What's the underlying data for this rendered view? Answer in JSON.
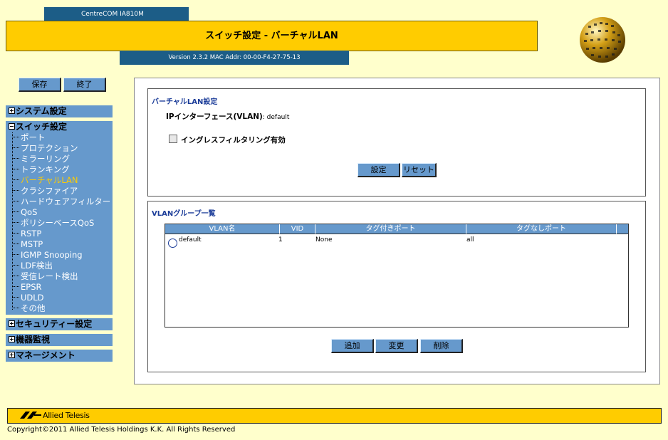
{
  "header": {
    "model": "CentreCOM IA810M",
    "title": "スイッチ設定 - バーチャルLAN",
    "version_info": "Version 2.3.2 MAC Addr: 00-00-F4-27-75-13"
  },
  "toolbar": {
    "save_label": "保存",
    "exit_label": "終了"
  },
  "menu": {
    "system": "システム設定",
    "switch": "スイッチ設定",
    "switch_items": [
      "ポート",
      "プロテクション",
      "ミラーリング",
      "トランキング",
      "バーチャルLAN",
      "クラシファイア",
      "ハードウェアフィルター",
      "QoS",
      "ポリシーベースQoS",
      "RSTP",
      "MSTP",
      "IGMP Snooping",
      "LDF検出",
      "受信レート検出",
      "EPSR",
      "UDLD",
      "その他"
    ],
    "security": "セキュリティー設定",
    "monitor": "機器監視",
    "management": "マネージメント"
  },
  "vlan_settings": {
    "title": "バーチャルLAN設定",
    "if_label": "IPインターフェース(VLAN)",
    "if_value": ": default",
    "ingress_label": "イングレスフィルタリング有効",
    "set_button": "設定",
    "reset_button": "リセット"
  },
  "vlan_group": {
    "title": "VLANグループ一覧",
    "columns": [
      "VLAN名",
      "VID",
      "タグ付きポート",
      "タグなしポート"
    ],
    "rows": [
      {
        "name": "default",
        "vid": "1",
        "tagged": "None",
        "untagged": "all"
      }
    ],
    "add_button": "追加",
    "edit_button": "変更",
    "delete_button": "削除"
  },
  "footer": {
    "logo_text": "Allied Telesis",
    "copyright": "Copyright©2011 Allied Telesis Holdings K.K. All Rights Reserved"
  },
  "colors": {
    "accent": "#FFCC00",
    "nav_blue": "#6699CC",
    "header_blue": "#1C5D87",
    "background": "#FFFFCC"
  }
}
